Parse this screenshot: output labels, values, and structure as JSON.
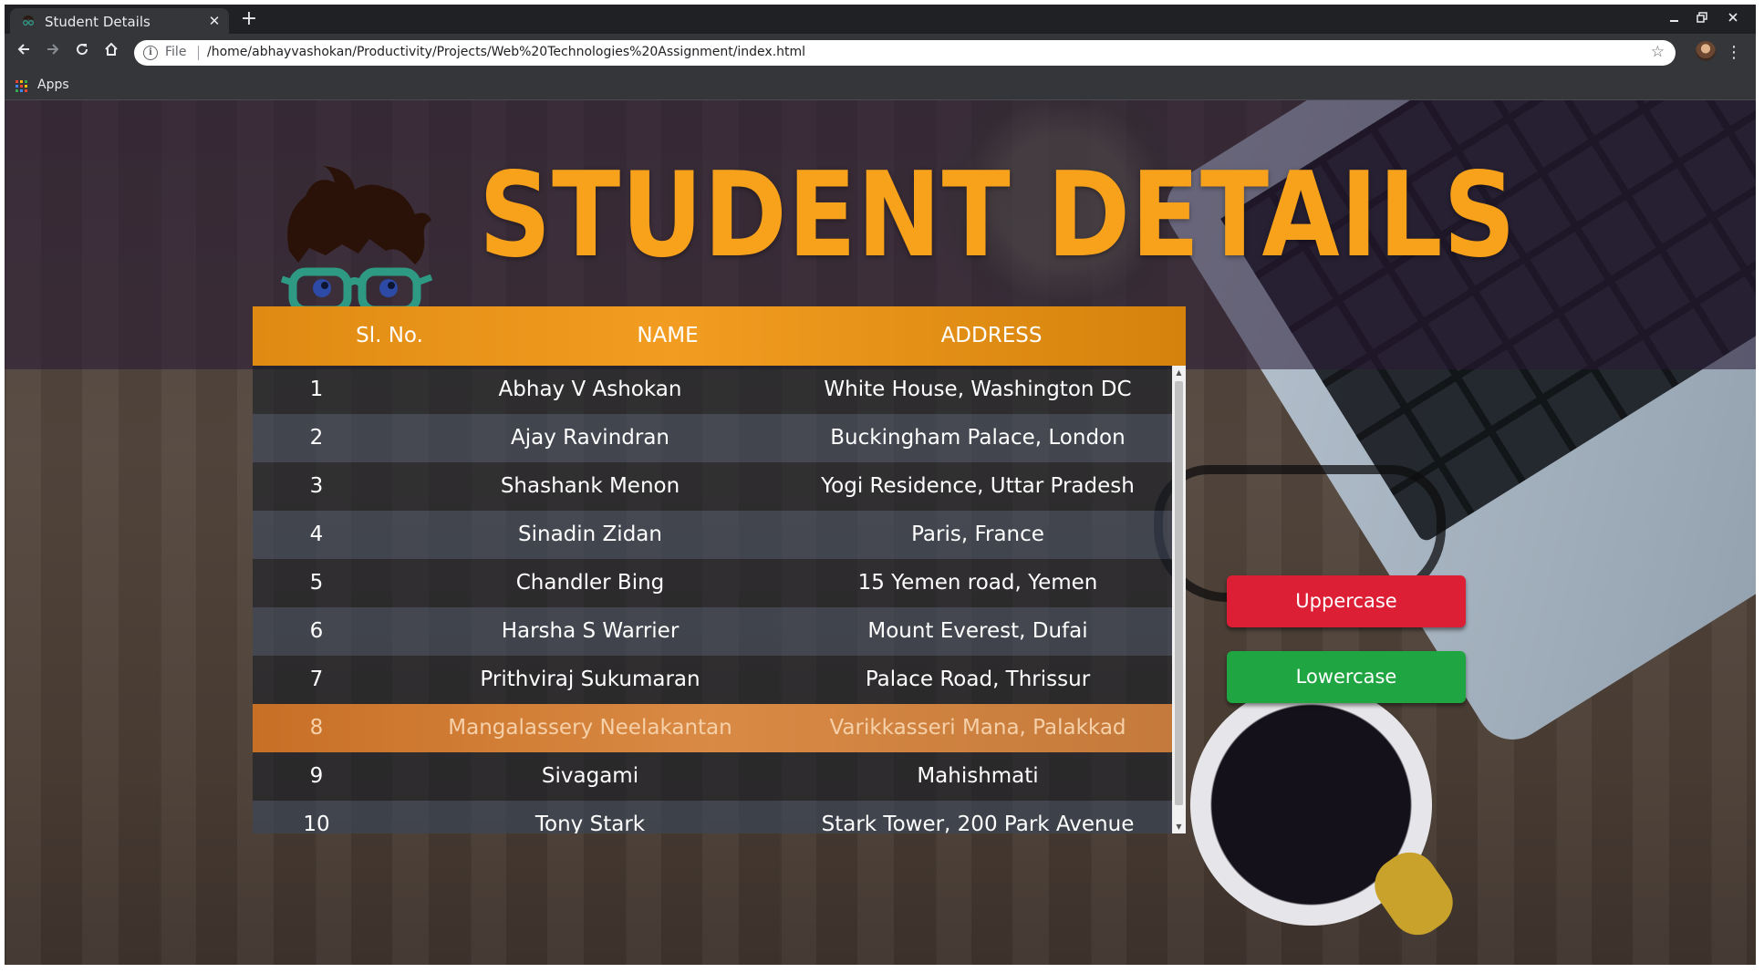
{
  "browser": {
    "tab_title": "Student Details",
    "tab_close": "✕",
    "new_tab": "+",
    "scheme_label": "File",
    "url": "/home/abhayvashokan/Productivity/Projects/Web%20Technologies%20Assignment/index.html",
    "bookmarks": {
      "apps_label": "Apps"
    },
    "icons": {
      "back": "arrow-left-icon",
      "forward": "arrow-right-icon",
      "reload": "reload-icon",
      "home": "home-icon",
      "info": "info-icon",
      "star": "star-icon",
      "menu": "kebab-menu-icon"
    }
  },
  "page": {
    "title": "STUDENT DETAILS",
    "title_color": "#f8a21b",
    "table": {
      "headers": [
        "Sl. No.",
        "NAME",
        "ADDRESS"
      ],
      "header_color": "#f29d21",
      "highlighted_row": 8,
      "rows": [
        {
          "sl": "1",
          "name": "Abhay V Ashokan",
          "address": "White House, Washington DC"
        },
        {
          "sl": "2",
          "name": "Ajay Ravindran",
          "address": "Buckingham Palace, London"
        },
        {
          "sl": "3",
          "name": "Shashank Menon",
          "address": "Yogi Residence, Uttar Pradesh"
        },
        {
          "sl": "4",
          "name": "Sinadin Zidan",
          "address": "Paris, France"
        },
        {
          "sl": "5",
          "name": "Chandler Bing",
          "address": "15 Yemen road, Yemen"
        },
        {
          "sl": "6",
          "name": "Harsha S Warrier",
          "address": "Mount Everest, Dufai"
        },
        {
          "sl": "7",
          "name": "Prithviraj Sukumaran",
          "address": "Palace Road, Thrissur"
        },
        {
          "sl": "8",
          "name": "Mangalassery Neelakantan",
          "address": "Varikkasseri Mana, Palakkad"
        },
        {
          "sl": "9",
          "name": "Sivagami",
          "address": "Mahishmati"
        },
        {
          "sl": "10",
          "name": "Tony Stark",
          "address": "Stark Tower, 200 Park Avenue"
        }
      ]
    },
    "buttons": {
      "uppercase": "Uppercase",
      "uppercase_color": "#dc1f35",
      "lowercase": "Lowercase",
      "lowercase_color": "#1fa541"
    }
  }
}
